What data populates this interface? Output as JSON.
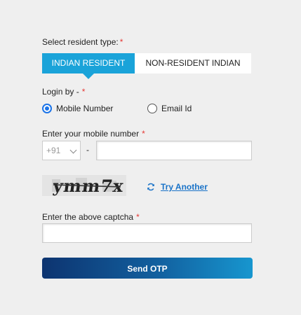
{
  "resident": {
    "label": "Select resident type:",
    "required_mark": "*",
    "tabs": [
      {
        "label": "INDIAN RESIDENT",
        "active": true
      },
      {
        "label": "NON-RESIDENT INDIAN",
        "active": false
      }
    ]
  },
  "login_by": {
    "label": "Login by -",
    "required_mark": "*",
    "options": [
      {
        "label": "Mobile Number",
        "checked": true
      },
      {
        "label": "Email Id",
        "checked": false
      }
    ]
  },
  "mobile": {
    "label": "Enter your mobile number",
    "required_mark": "*",
    "country_code": "+91",
    "separator": "-",
    "value": ""
  },
  "captcha": {
    "image_text": "ymm7x",
    "try_another_label": "Try Another",
    "input_label": "Enter the above captcha",
    "required_mark": "*",
    "value": ""
  },
  "submit": {
    "label": "Send OTP"
  },
  "colors": {
    "accent": "#1aa3d9",
    "link": "#1a73c8",
    "required": "#e53935",
    "button_start": "#0d3470",
    "button_end": "#1796cf"
  }
}
